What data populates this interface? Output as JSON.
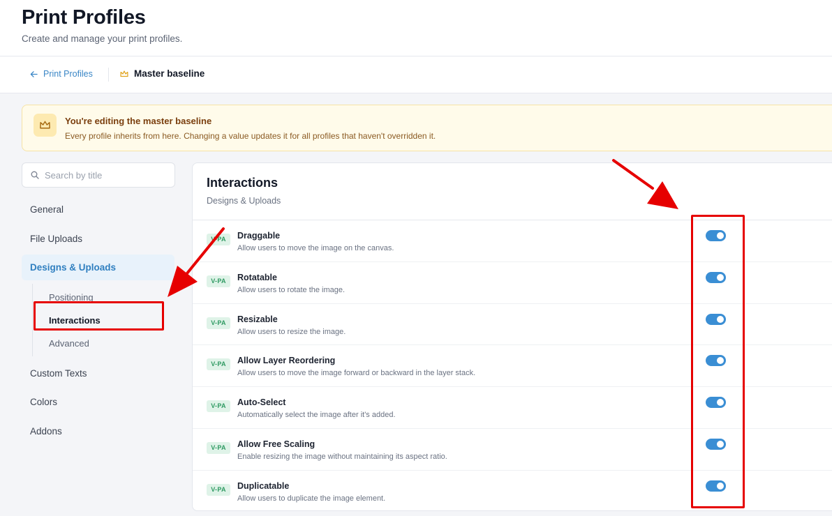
{
  "header": {
    "title": "Print Profiles",
    "subtitle": "Create and manage your print profiles."
  },
  "breadcrumb": {
    "back_label": "Print Profiles",
    "current_label": "Master baseline",
    "back_icon": "arrow-left-icon",
    "current_icon": "crown-icon"
  },
  "banner": {
    "title": "You're editing the master baseline",
    "text": "Every profile inherits from here. Changing a value updates it for all profiles that haven't overridden it.",
    "icon": "crown-icon"
  },
  "search": {
    "placeholder": "Search by title",
    "value": ""
  },
  "sidebar": {
    "items": [
      {
        "label": "General"
      },
      {
        "label": "File Uploads"
      },
      {
        "label": "Designs & Uploads",
        "active": true
      },
      {
        "label": "Custom Texts"
      },
      {
        "label": "Colors"
      },
      {
        "label": "Addons"
      }
    ],
    "sub_items": [
      {
        "label": "Positioning"
      },
      {
        "label": "Interactions",
        "active": true
      },
      {
        "label": "Advanced"
      }
    ]
  },
  "panel": {
    "title": "Interactions",
    "subtitle": "Designs & Uploads",
    "settings": [
      {
        "badge": "V-PA",
        "title": "Draggable",
        "description": "Allow users to move the image on the canvas.",
        "enabled": true
      },
      {
        "badge": "V-PA",
        "title": "Rotatable",
        "description": "Allow users to rotate the image.",
        "enabled": true
      },
      {
        "badge": "V-PA",
        "title": "Resizable",
        "description": "Allow users to resize the image.",
        "enabled": true
      },
      {
        "badge": "V-PA",
        "title": "Allow Layer Reordering",
        "description": "Allow users to move the image forward or backward in the layer stack.",
        "enabled": true
      },
      {
        "badge": "V-PA",
        "title": "Auto-Select",
        "description": "Automatically select the image after it's added.",
        "enabled": true
      },
      {
        "badge": "V-PA",
        "title": "Allow Free Scaling",
        "description": "Enable resizing the image without maintaining its aspect ratio.",
        "enabled": true
      },
      {
        "badge": "V-PA",
        "title": "Duplicatable",
        "description": "Allow users to duplicate the image element.",
        "enabled": true
      }
    ]
  },
  "colors": {
    "accent": "#3a8ed4",
    "annotation": "#e60000",
    "banner_bg": "#fffbea",
    "badge_bg": "#dff3e8"
  }
}
